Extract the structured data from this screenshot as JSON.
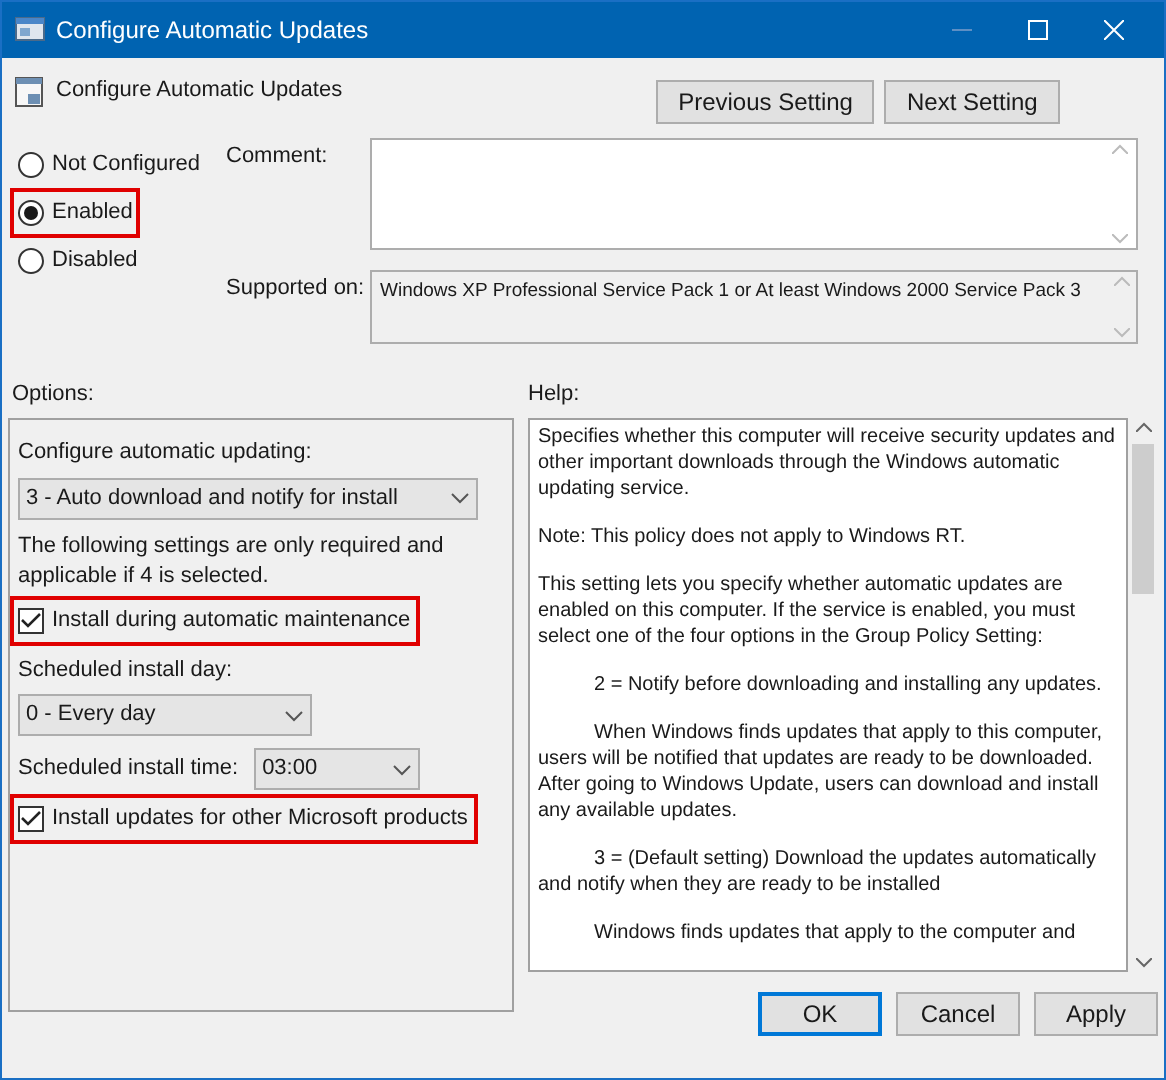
{
  "window": {
    "title": "Configure Automatic Updates"
  },
  "header": {
    "title": "Configure Automatic Updates"
  },
  "nav_buttons": [
    "Previous Setting",
    "Next Setting"
  ],
  "state_options": [
    {
      "label": "Not Configured",
      "selected": false,
      "highlighted": false
    },
    {
      "label": "Enabled",
      "selected": true,
      "highlighted": true
    },
    {
      "label": "Disabled",
      "selected": false,
      "highlighted": false
    }
  ],
  "comment": {
    "label": "Comment:"
  },
  "supported_on": {
    "label": "Supported on:",
    "value": "Windows XP Professional Service Pack 1 or At least Windows 2000 Service Pack 3"
  },
  "options": {
    "label": "Options:",
    "items": [
      {
        "kind": "label",
        "text": "Configure automatic updating:"
      },
      {
        "kind": "dropdown",
        "value": "3 - Auto download and notify for install"
      },
      {
        "kind": "note",
        "text": "The following settings are only required and applicable if 4 is selected."
      },
      {
        "kind": "checkbox",
        "text": "Install during automatic maintenance",
        "checked": true,
        "highlighted": true
      },
      {
        "kind": "label",
        "text": "Scheduled install day:"
      },
      {
        "kind": "dropdown",
        "value": "0 - Every day"
      },
      {
        "kind": "inline_dropdown",
        "text": "Scheduled install time:",
        "value": "03:00"
      },
      {
        "kind": "checkbox",
        "text": "Install updates for other Microsoft products",
        "checked": true,
        "highlighted": true
      }
    ]
  },
  "help": {
    "label": "Help:",
    "paragraphs": [
      {
        "text": "Specifies whether this computer will receive security updates and other important downloads through the Windows automatic updating service.",
        "indent": false
      },
      {
        "text": "Note: This policy does not apply to Windows RT.",
        "indent": false
      },
      {
        "text": "This setting lets you specify whether automatic updates are enabled on this computer. If the service is enabled, you must select one of the four options in the Group Policy Setting:",
        "indent": false
      },
      {
        "text": "2 = Notify before downloading and installing any updates.",
        "indent": true
      },
      {
        "text": "When Windows finds updates that apply to this computer, users will be notified that updates are ready to be downloaded. After going to Windows Update, users can download and install any available updates.",
        "indent": true
      },
      {
        "text": "3 = (Default setting) Download the updates automatically and notify when they are ready to be installed",
        "indent": true
      },
      {
        "text": "Windows finds updates that apply to the computer and",
        "indent": true
      }
    ]
  },
  "footer_buttons": [
    {
      "label": "OK",
      "focused": true
    },
    {
      "label": "Cancel",
      "focused": false
    },
    {
      "label": "Apply",
      "focused": false
    }
  ]
}
